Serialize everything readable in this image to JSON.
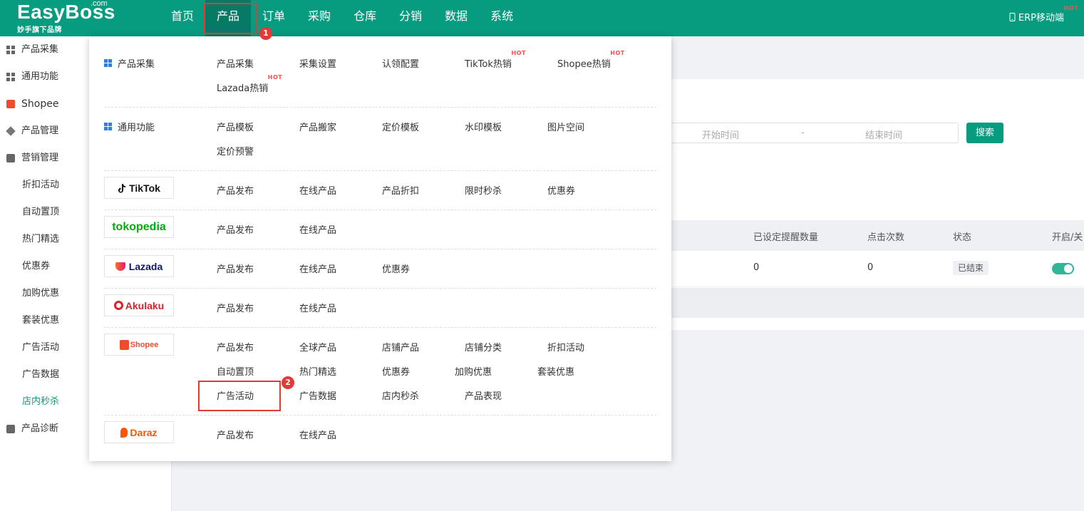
{
  "logo": {
    "main": "EasyBoss",
    "com": ".com",
    "sub": "妙手旗下品牌"
  },
  "nav": {
    "items": [
      "首页",
      "产品",
      "订单",
      "采购",
      "仓库",
      "分销",
      "数据",
      "系统"
    ],
    "active": "产品",
    "mobile_link": "ERP移动端",
    "hot": "HOT"
  },
  "sidebar": {
    "items": [
      {
        "label": "产品采集",
        "icon": "grid-icon"
      },
      {
        "label": "通用功能",
        "icon": "grid-icon"
      },
      {
        "label": "Shopee",
        "icon": "shopee-bag-icon"
      },
      {
        "label": "产品管理",
        "icon": "box-icon"
      },
      {
        "label": "营销管理",
        "icon": "ad-icon"
      }
    ],
    "sub_items": [
      "折扣活动",
      "自动置顶",
      "热门精选",
      "优惠券",
      "加购优惠",
      "套装优惠",
      "广告活动",
      "广告数据",
      "店内秒杀"
    ],
    "active_sub": "店内秒杀",
    "last_item": {
      "label": "产品诊断",
      "icon": "ad-icon"
    }
  },
  "filter": {
    "start_placeholder": "开始时间",
    "separator": "-",
    "end_placeholder": "结束时间",
    "search_label": "搜索"
  },
  "table": {
    "headers": [
      "已设定提醒数量",
      "点击次数",
      "状态",
      "开启/关"
    ],
    "row": {
      "reminders": "0",
      "clicks": "0",
      "status": "已结束",
      "enabled": true
    }
  },
  "dropdown": {
    "sections": [
      {
        "title": "产品采集",
        "links": [
          "产品采集",
          "采集设置",
          "认领配置",
          "TikTok热销",
          "Shopee热销",
          "Lazada热销"
        ],
        "hot_links": [
          "TikTok热销",
          "Shopee热销",
          "Lazada热销"
        ]
      },
      {
        "title": "通用功能",
        "links": [
          "产品模板",
          "产品搬家",
          "定价模板",
          "水印模板",
          "图片空间",
          "定价预警"
        ]
      },
      {
        "brand": "TikTok",
        "links": [
          "产品发布",
          "在线产品",
          "产品折扣",
          "限时秒杀",
          "优惠券"
        ]
      },
      {
        "brand": "tokopedia",
        "links": [
          "产品发布",
          "在线产品"
        ]
      },
      {
        "brand": "Lazada",
        "links": [
          "产品发布",
          "在线产品",
          "优惠券"
        ]
      },
      {
        "brand": "Akulaku",
        "links": [
          "产品发布",
          "在线产品"
        ]
      },
      {
        "brand": "Shopee",
        "links": [
          "产品发布",
          "全球产品",
          "店铺产品",
          "店铺分类",
          "折扣活动",
          "自动置顶",
          "热门精选",
          "优惠券",
          "加购优惠",
          "套装优惠",
          "广告活动",
          "广告数据",
          "店内秒杀",
          "产品表现"
        ]
      },
      {
        "brand": "Daraz",
        "links": [
          "产品发布",
          "在线产品"
        ]
      }
    ]
  },
  "annotations": [
    "1",
    "2"
  ],
  "colors": {
    "primary": "#079b80",
    "highlight": "#e53935",
    "hot": "#ff4d4f"
  }
}
